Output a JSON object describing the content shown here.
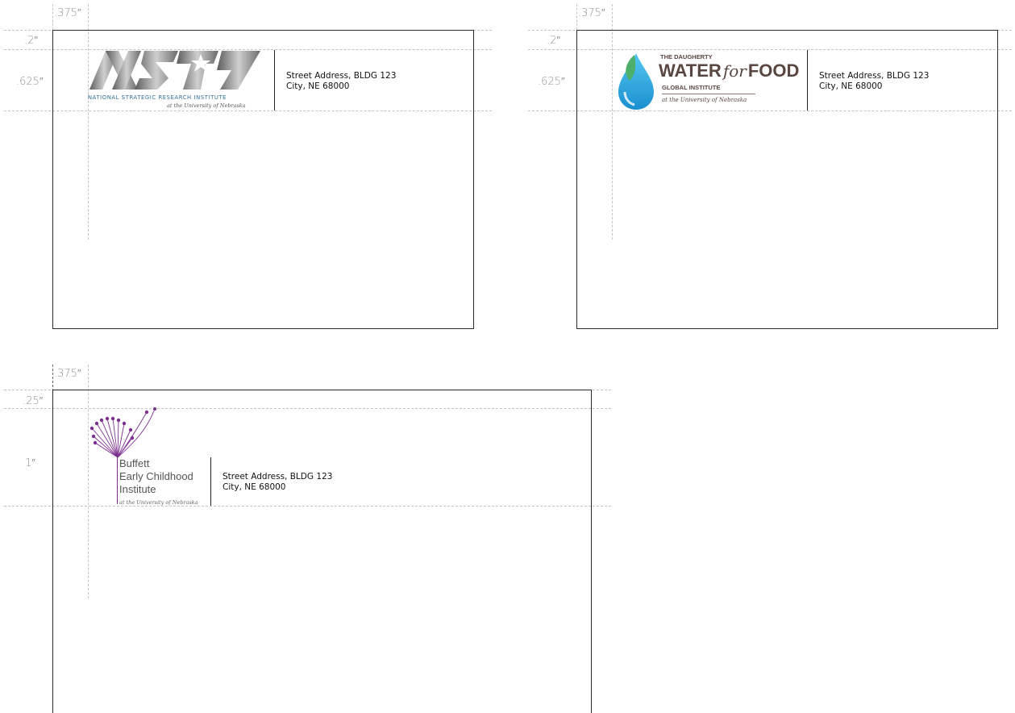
{
  "envelopes": [
    {
      "logo": {
        "mark_text": "NSRI",
        "name_line": "NATIONAL STRATEGIC RESEARCH INSTITUTE",
        "affiliation": "at the University of Nebraska"
      },
      "address": {
        "line1": "Street Address, BLDG 123",
        "line2": "City, NE 68000"
      },
      "dims": {
        "left": ".375″",
        "top": ".2″",
        "height": ".625″"
      }
    },
    {
      "logo": {
        "line_top": "THE DAUGHERTY",
        "line_main_a": "WATER",
        "line_main_b": "for",
        "line_main_c": "FOOD",
        "line_sub": "GLOBAL INSTITUTE",
        "affiliation": "at the University of Nebraska"
      },
      "address": {
        "line1": "Street Address, BLDG 123",
        "line2": "City, NE 68000"
      },
      "dims": {
        "left": ".375″",
        "top": ".2″",
        "height": ".625″"
      }
    },
    {
      "logo": {
        "line1": "Buffett",
        "line2": "Early Childhood",
        "line3": "Institute",
        "affiliation": "at the University of Nebraska"
      },
      "address": {
        "line1": "Street Address, BLDG 123",
        "line2": "City, NE 68000"
      },
      "dims": {
        "left": ".375″",
        "top": ".25″",
        "height": "1″"
      }
    }
  ],
  "colors": {
    "nsri_blue": "#2e6f95",
    "wff_brown": "#5a4640",
    "wff_drop": "#29a3d9",
    "wff_leaf": "#4caf6a",
    "buffett_purple": "#7b2f8f",
    "guide": "#c4c4c4",
    "border": "#2b2b2b"
  }
}
